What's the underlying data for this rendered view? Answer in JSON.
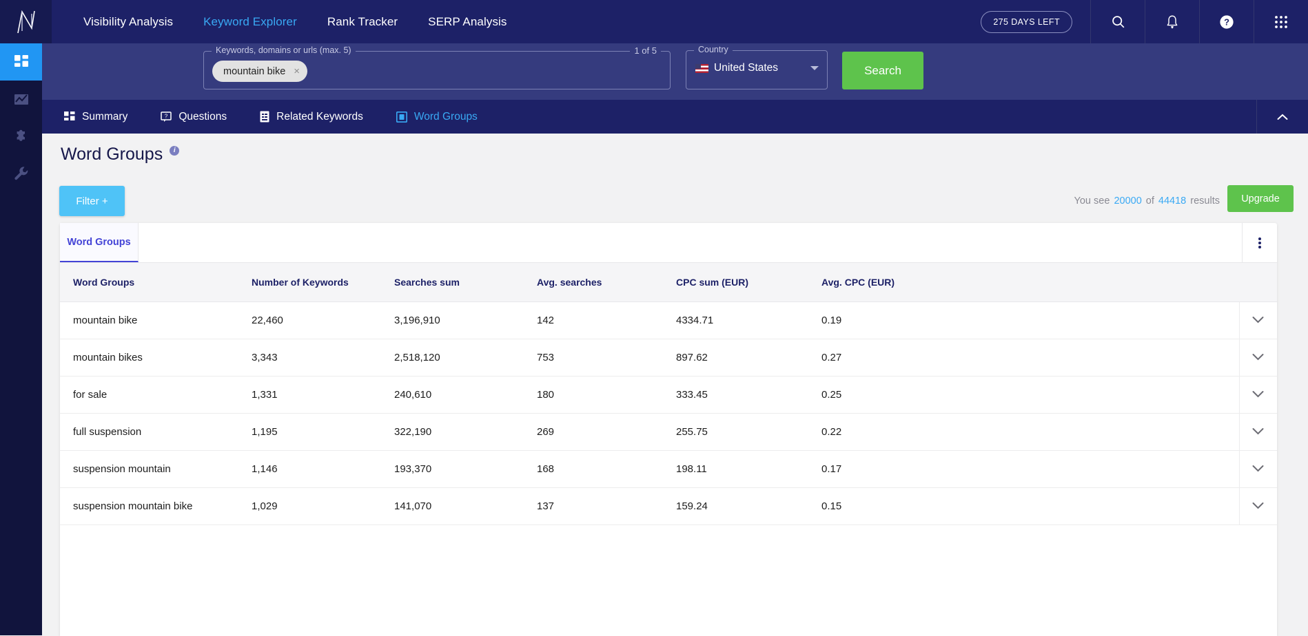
{
  "topnav": {
    "logo": "brand-logo",
    "links": [
      {
        "label": "Visibility Analysis",
        "active": false
      },
      {
        "label": "Keyword Explorer",
        "active": true
      },
      {
        "label": "Rank Tracker",
        "active": false
      },
      {
        "label": "SERP Analysis",
        "active": false
      }
    ],
    "days_left": "275 DAYS LEFT",
    "icons": [
      "search-icon",
      "bell-icon",
      "help-icon",
      "apps-grid-icon"
    ]
  },
  "sidebar": {
    "items": [
      {
        "name": "dashboard",
        "icon": "dashboard-icon",
        "active": true
      },
      {
        "name": "analytics",
        "icon": "chart-icon",
        "active": false
      },
      {
        "name": "extensions",
        "icon": "puzzle-icon",
        "active": false
      },
      {
        "name": "tools",
        "icon": "wrench-icon",
        "active": false
      }
    ]
  },
  "searchbar": {
    "keywords_legend": "Keywords, domains or urls (max. 5)",
    "keywords_count": "1 of 5",
    "chip": "mountain bike",
    "chip_remove": "×",
    "country_legend": "Country",
    "country_value": "United States",
    "search_button": "Search"
  },
  "tabs": [
    {
      "label": "Summary",
      "icon": "grid-icon",
      "active": false
    },
    {
      "label": "Questions",
      "icon": "question-bubble-icon",
      "active": false
    },
    {
      "label": "Related Keywords",
      "icon": "document-icon",
      "active": false
    },
    {
      "label": "Word Groups",
      "icon": "word-groups-icon",
      "active": true
    }
  ],
  "main": {
    "title": "Word Groups",
    "info_tooltip": "i",
    "filter_button": "Filter +",
    "results_prefix": "You see",
    "results_shown": "20000",
    "results_middle": "of",
    "results_total": "44418",
    "results_suffix": "results",
    "upgrade_button": "Upgrade",
    "card_tab": "Word Groups"
  },
  "table": {
    "columns": [
      "Word Groups",
      "Number of Keywords",
      "Searches sum",
      "Avg. searches",
      "CPC sum (EUR)",
      "Avg. CPC (EUR)"
    ],
    "rows": [
      [
        "mountain bike",
        "22,460",
        "3,196,910",
        "142",
        "4334.71",
        "0.19"
      ],
      [
        "mountain bikes",
        "3,343",
        "2,518,120",
        "753",
        "897.62",
        "0.27"
      ],
      [
        "for sale",
        "1,331",
        "240,610",
        "180",
        "333.45",
        "0.25"
      ],
      [
        "full suspension",
        "1,195",
        "322,190",
        "269",
        "255.75",
        "0.22"
      ],
      [
        "suspension mountain",
        "1,146",
        "193,370",
        "168",
        "198.11",
        "0.17"
      ],
      [
        "suspension mountain bike",
        "1,029",
        "141,070",
        "137",
        "159.24",
        "0.15"
      ]
    ]
  },
  "colors": {
    "nav_bg": "#1d2167",
    "sidebar_bg": "#11143d",
    "searchbar_bg": "#353b7e",
    "accent_blue": "#39a9f4",
    "accent_green": "#5ec34c",
    "filter_blue": "#4fc3f7",
    "tab_purple": "#4343d6"
  }
}
